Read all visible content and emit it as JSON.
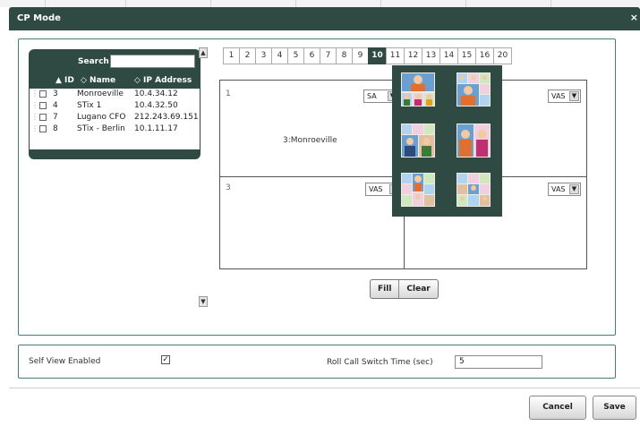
{
  "dialog": {
    "title": "CP Mode",
    "close_glyph": "×"
  },
  "sites_list": {
    "search_label": "Search",
    "search_value": "",
    "columns": {
      "id": "▲ ID",
      "name": "◇ Name",
      "ip": "◇ IP Address"
    },
    "rows": [
      {
        "id": "3",
        "name": "Monroeville",
        "ip": "10.4.34.12"
      },
      {
        "id": "4",
        "name": "STix 1",
        "ip": "10.4.32.50"
      },
      {
        "id": "7",
        "name": "Lugano CFO",
        "ip": "212.243.69.151"
      },
      {
        "id": "8",
        "name": "STix - Berlin",
        "ip": "10.1.11.17"
      }
    ]
  },
  "layout_tabs": {
    "items": [
      "1",
      "2",
      "3",
      "4",
      "5",
      "6",
      "7",
      "8",
      "9",
      "10",
      "11",
      "12",
      "13",
      "14",
      "15",
      "16",
      "20"
    ],
    "active": "10"
  },
  "cp_grid": {
    "cells": [
      {
        "number": "1",
        "site": "3:Monroeville",
        "select": "SA"
      },
      {
        "number": "",
        "site": "",
        "select": "VAS"
      },
      {
        "number": "3",
        "site": "",
        "select": "VAS"
      },
      {
        "number": "",
        "site": "",
        "select": "VAS"
      }
    ]
  },
  "grid_actions": {
    "fill_label": "Fill",
    "clear_label": "Clear"
  },
  "settings": {
    "self_view_label": "Self View Enabled",
    "self_view_checked": true,
    "rollcall_label": "Roll Call Switch Time (sec)",
    "rollcall_value": "5"
  },
  "footer": {
    "cancel_label": "Cancel",
    "save_label": "Save"
  },
  "colors": {
    "panel_dark": "#2e4a43",
    "frame_border": "#4a7a70",
    "background": "#ffffff"
  },
  "icons": {
    "checkmark": "checkmark-icon",
    "dropdown": "dropdown-arrow-icon",
    "drag": "drag-handle-icon",
    "scroll_up": "scroll-up-icon",
    "scroll_down": "scroll-down-icon",
    "close": "close-icon",
    "layout": "layout-thumbnail-icon"
  }
}
